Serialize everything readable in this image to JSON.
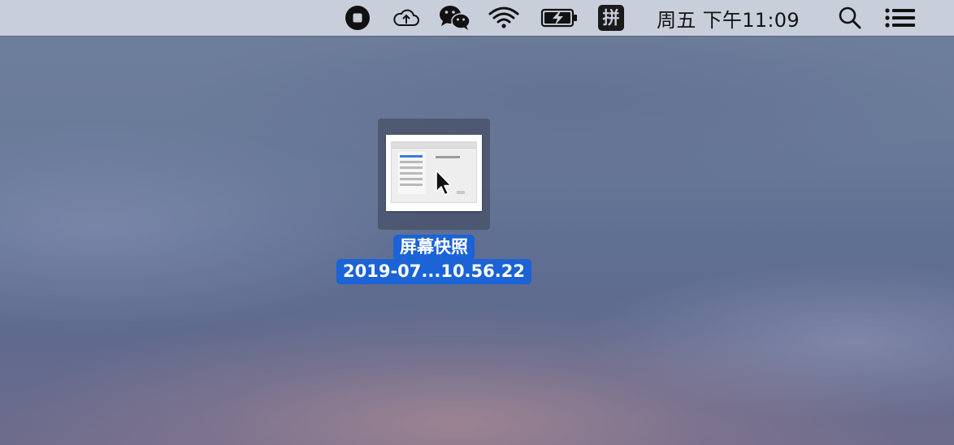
{
  "menubar": {
    "icons": [
      "record-stop-icon",
      "cloud-upload-icon",
      "wechat-icon",
      "wifi-icon",
      "battery-charging-icon",
      "input-method-icon",
      "search-icon",
      "notification-center-icon"
    ],
    "input_method_label": "拼",
    "clock": "周五 下午11:09"
  },
  "desktop": {
    "file": {
      "name_line1": "屏幕快照",
      "name_line2": "2019-07...10.56.22",
      "selection_color": "#1b63d6"
    }
  }
}
